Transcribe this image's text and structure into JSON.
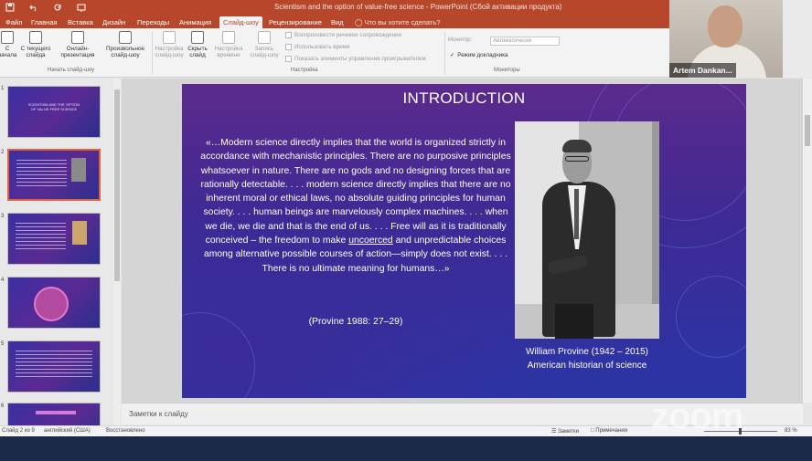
{
  "window": {
    "title": "Scientism and the option of value-free science - PowerPoint (Сбой активации продукта)",
    "qat_icons": [
      "save-icon",
      "undo-icon",
      "redo-icon",
      "slideshow-icon"
    ]
  },
  "ribbon": {
    "tabs": [
      "Файл",
      "Главная",
      "Вставка",
      "Дизайн",
      "Переходы",
      "Анимация",
      "Слайд-шоу",
      "Рецензирование",
      "Вид"
    ],
    "active_tab": "Слайд-шоу",
    "tell_me": "Что вы хотите сделать?",
    "start_group": {
      "label": "Начать слайд-шоу",
      "buttons": [
        "С начала",
        "С текущего слайда",
        "Онлайн-презентация",
        "Произвольное слайд-шоу"
      ]
    },
    "setup_group": {
      "label": "Настройка",
      "buttons": [
        "Настройка слайд-шоу",
        "Скрыть слайд",
        "Настройка времени",
        "Запись слайд-шоу"
      ],
      "checkboxes": [
        "Воспроизвести речевое сопровождение",
        "Использовать время",
        "Показать элементы управления проигрывателем"
      ]
    },
    "monitors_group": {
      "label": "Мониторы",
      "monitor_label": "Монитор:",
      "monitor_value": "Автоматически",
      "presenter_view": "Режим докладчика"
    }
  },
  "webcam": {
    "name": "Artem Dankan..."
  },
  "thumbnails": {
    "numbers": [
      "1",
      "2",
      "3",
      "4",
      "5",
      "6"
    ],
    "selected": 2,
    "slide1_title": "SCIENTISM AND THE OPTION OF VALUE-FREE SCIENCE"
  },
  "slide": {
    "title": "INTRODUCTION",
    "quote_part1": "«…Modern science directly implies that the world is organized strictly in accordance with mechanistic principles. There are no purposive principles whatsoever in nature. There are no gods and no designing forces that are rationally detectable. . . . modern science directly implies that there are no inherent moral or ethical laws, no absolute guiding principles for human society. . . . human beings are marvelously complex machines. . . . when we die, we die and that is the end of us. . . . Free will as it is traditionally conceived – the freedom to make ",
    "quote_underlined": "uncoerced",
    "quote_part2": " and unpredictable choices among alternative possible courses of action—simply does not exist. . . . There is no ultimate meaning for humans…»",
    "citation": "(Provine 1988: 27–29)",
    "caption_line1": "William Provine (1942 – 2015)",
    "caption_line2": "American historian of science"
  },
  "notes": {
    "placeholder": "Заметки к слайду"
  },
  "statusbar": {
    "slide_counter": "Слайд 2 из 9",
    "language": "английский (США)",
    "recovered": "Восстановлено",
    "notes_button": "Заметки",
    "comments_button": "Примечания",
    "zoom": "83 %"
  },
  "watermark": "zoom"
}
